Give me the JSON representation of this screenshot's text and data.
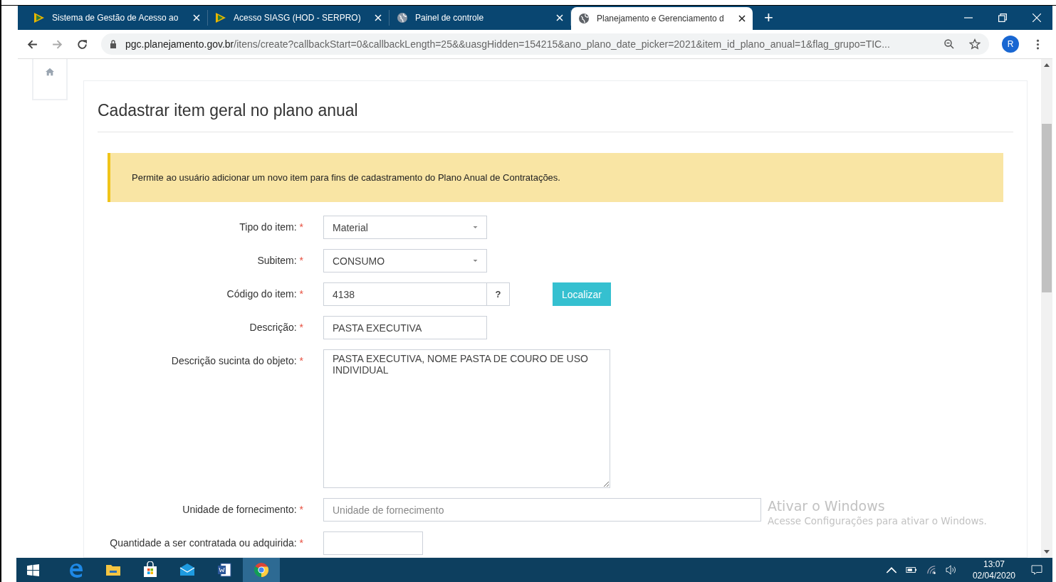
{
  "browser": {
    "tabs": [
      {
        "title": "Sistema de Gestão de Acesso ao",
        "kind": "logo",
        "selected": false
      },
      {
        "title": "Acesso SIASG (HOD - SERPRO)",
        "kind": "logo",
        "selected": false
      },
      {
        "title": "Painel de controle",
        "kind": "globe",
        "selected": false
      },
      {
        "title": "Planejamento e Gerenciamento d",
        "kind": "globe",
        "selected": true
      }
    ],
    "new_tab": "+",
    "url_host": "pgc.planejamento.gov.br",
    "url_path": "/itens/create?callbackStart=0&callbackLength=25&&uasgHidden=154215&ano_plano_date_picker=2021&item_id_plano_anual=1&flag_grupo=TIC...",
    "profile": "R"
  },
  "page": {
    "title": "Cadastrar item geral no plano anual",
    "alert": "Permite ao usuário adicionar um novo item para fins de cadastramento do Plano Anual de Contratações.",
    "fields": [
      {
        "kind": "select",
        "label": "Tipo do item:",
        "mark": "*",
        "value": "Material"
      },
      {
        "kind": "select",
        "label": "Subitem:",
        "mark": "*",
        "value": "CONSUMO"
      },
      {
        "kind": "lookup",
        "label": "Código do item:",
        "mark": "*",
        "value": "4138",
        "help": "?",
        "button": "Localizar"
      },
      {
        "kind": "text",
        "label": "Descrição:",
        "mark": "*",
        "value": "PASTA EXECUTIVA"
      },
      {
        "kind": "textarea",
        "label": "Descrição sucinta do objeto:",
        "mark": "*",
        "value": "PASTA EXECUTIVA, NOME PASTA DE COURO DE USO INDIVIDUAL"
      },
      {
        "kind": "wide",
        "label": "Unidade de fornecimento:",
        "mark": "*",
        "placeholder": "Unidade de fornecimento"
      },
      {
        "kind": "short",
        "label": "Quantidade a ser contratada ou adquirida:",
        "mark": "*"
      }
    ]
  },
  "activation": {
    "title": "Ativar o Windows",
    "text": "Acesse Configurações para ativar o Windows."
  },
  "taskbar": {
    "apps": [
      {
        "kind": "edge",
        "selected": false
      },
      {
        "kind": "folder",
        "selected": false
      },
      {
        "kind": "store",
        "selected": false
      },
      {
        "kind": "mail",
        "selected": false
      },
      {
        "kind": "word",
        "selected": false
      },
      {
        "kind": "chrome",
        "selected": true
      }
    ],
    "time": "13:07",
    "date": "02/04/2020"
  }
}
